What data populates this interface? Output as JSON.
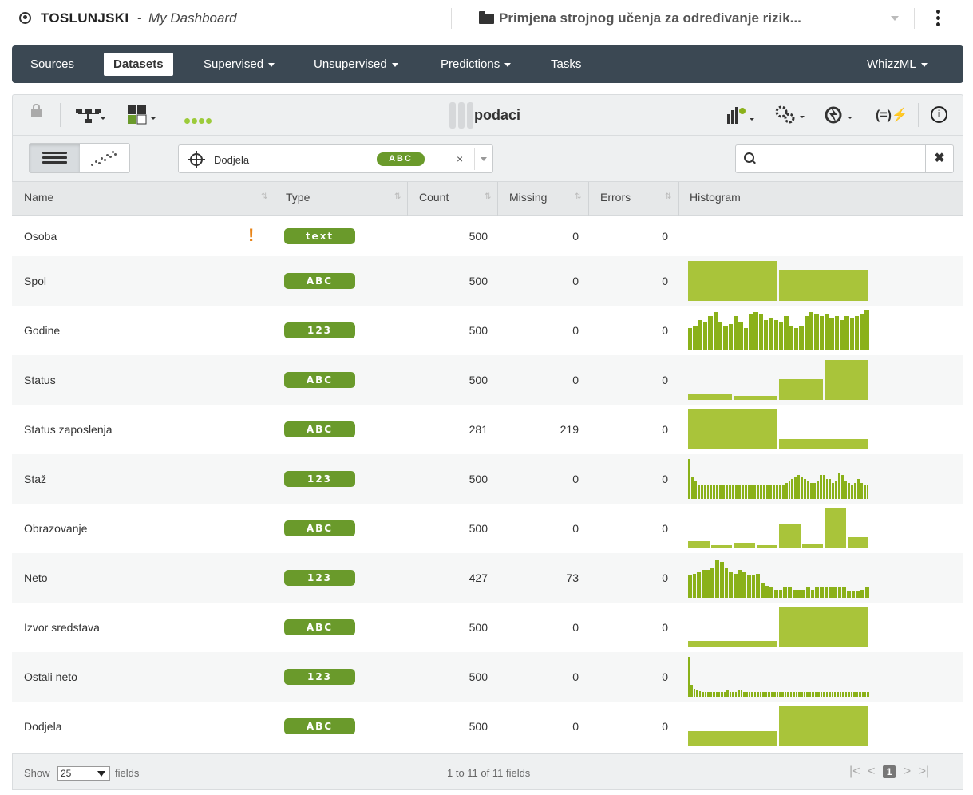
{
  "header": {
    "user": "TOSLUNJSKI",
    "separator": "-",
    "dashboard": "My Dashboard",
    "project": "Primjena strojnog učenja za određivanje rizik..."
  },
  "nav": {
    "sources": "Sources",
    "datasets": "Datasets",
    "supervised": "Supervised",
    "unsupervised": "Unsupervised",
    "predictions": "Predictions",
    "tasks": "Tasks",
    "whizzml": "WhizzML"
  },
  "resource": {
    "name": "podaci",
    "formula_icon": "(=)⚡"
  },
  "filter": {
    "field_value": "Dodjela",
    "field_type": "ABC",
    "clear": "×",
    "search_placeholder": "",
    "search_clear": "✖"
  },
  "table": {
    "headers": [
      "Name",
      "Type",
      "Count",
      "Missing",
      "Errors",
      "Histogram"
    ],
    "rows": [
      {
        "name": "Osoba",
        "type": "text",
        "count": "500",
        "missing": "0",
        "errors": "0",
        "warning": "!",
        "hist": []
      },
      {
        "name": "Spol",
        "type": "ABC",
        "count": "500",
        "missing": "0",
        "errors": "0",
        "hist": [
          1.0,
          0.78
        ]
      },
      {
        "name": "Godine",
        "type": "123",
        "count": "500",
        "missing": "0",
        "errors": "0",
        "hist": [
          0.55,
          0.6,
          0.75,
          0.7,
          0.85,
          0.95,
          0.7,
          0.6,
          0.65,
          0.85,
          0.7,
          0.55,
          0.9,
          0.95,
          0.9,
          0.75,
          0.8,
          0.75,
          0.7,
          0.85,
          0.6,
          0.55,
          0.6,
          0.85,
          0.95,
          0.9,
          0.85,
          0.9,
          0.8,
          0.85,
          0.75,
          0.85,
          0.8,
          0.85,
          0.9,
          1.0
        ]
      },
      {
        "name": "Status",
        "type": "ABC",
        "count": "500",
        "missing": "0",
        "errors": "0",
        "hist": [
          0.15,
          0.1,
          0.52,
          1.0
        ]
      },
      {
        "name": "Status zaposlenja",
        "type": "ABC",
        "count": "281",
        "missing": "219",
        "errors": "0",
        "hist": [
          1.0,
          0.26
        ]
      },
      {
        "name": "Staž",
        "type": "123",
        "count": "500",
        "missing": "0",
        "errors": "0",
        "hist": [
          1.0,
          0.55,
          0.45,
          0.35,
          0.35,
          0.35,
          0.35,
          0.35,
          0.35,
          0.35,
          0.35,
          0.35,
          0.35,
          0.35,
          0.35,
          0.35,
          0.35,
          0.35,
          0.35,
          0.35,
          0.35,
          0.35,
          0.35,
          0.35,
          0.35,
          0.35,
          0.35,
          0.35,
          0.35,
          0.35,
          0.35,
          0.4,
          0.45,
          0.5,
          0.55,
          0.6,
          0.55,
          0.5,
          0.45,
          0.4,
          0.4,
          0.45,
          0.6,
          0.6,
          0.5,
          0.5,
          0.4,
          0.45,
          0.65,
          0.6,
          0.45,
          0.4,
          0.35,
          0.4,
          0.5,
          0.4,
          0.35,
          0.35
        ]
      },
      {
        "name": "Obrazovanje",
        "type": "ABC",
        "count": "500",
        "missing": "0",
        "errors": "0",
        "hist": [
          0.17,
          0.07,
          0.14,
          0.08,
          0.62,
          0.1,
          1.0,
          0.29
        ]
      },
      {
        "name": "Neto",
        "type": "123",
        "count": "427",
        "missing": "73",
        "errors": "0",
        "hist": [
          0.55,
          0.6,
          0.65,
          0.7,
          0.7,
          0.75,
          0.95,
          0.9,
          0.75,
          0.65,
          0.6,
          0.7,
          0.65,
          0.55,
          0.55,
          0.6,
          0.35,
          0.3,
          0.25,
          0.2,
          0.2,
          0.25,
          0.25,
          0.2,
          0.2,
          0.2,
          0.25,
          0.2,
          0.25,
          0.25,
          0.25,
          0.25,
          0.25,
          0.25,
          0.25,
          0.15,
          0.15,
          0.15,
          0.2,
          0.25
        ]
      },
      {
        "name": "Izvor sredstava",
        "type": "ABC",
        "count": "500",
        "missing": "0",
        "errors": "0",
        "hist": [
          0.15,
          1.0
        ]
      },
      {
        "name": "Ostali neto",
        "type": "123",
        "count": "500",
        "missing": "0",
        "errors": "0",
        "hist": [
          1.0,
          0.3,
          0.2,
          0.15,
          0.13,
          0.12,
          0.12,
          0.12,
          0.12,
          0.12,
          0.12,
          0.12,
          0.12,
          0.12,
          0.15,
          0.12,
          0.12,
          0.12,
          0.15,
          0.15,
          0.12,
          0.12,
          0.12,
          0.12,
          0.12,
          0.12,
          0.12,
          0.12,
          0.12,
          0.12,
          0.12,
          0.12,
          0.12,
          0.12,
          0.12,
          0.12,
          0.12,
          0.12,
          0.12,
          0.12,
          0.12,
          0.12,
          0.12,
          0.12,
          0.12,
          0.12,
          0.12,
          0.12,
          0.12,
          0.12,
          0.12,
          0.12,
          0.12,
          0.12,
          0.12,
          0.12,
          0.12,
          0.12,
          0.12,
          0.12,
          0.12,
          0.12,
          0.12,
          0.12,
          0.12,
          0.12
        ]
      },
      {
        "name": "Dodjela",
        "type": "ABC",
        "count": "500",
        "missing": "0",
        "errors": "0",
        "hist": [
          0.38,
          1.0
        ]
      }
    ]
  },
  "footer": {
    "show_label": "Show",
    "page_size": "25",
    "fields_label": "fields",
    "range": "1 to 11 of 11 fields",
    "current_page": "1",
    "first": "|<",
    "prev": "<",
    "next": ">",
    "last": ">|"
  },
  "colors": {
    "nav_bg": "#3b4853",
    "badge_green": "#6a9a2b",
    "hist_green": "#a9c43a",
    "warning_orange": "#e88418"
  }
}
